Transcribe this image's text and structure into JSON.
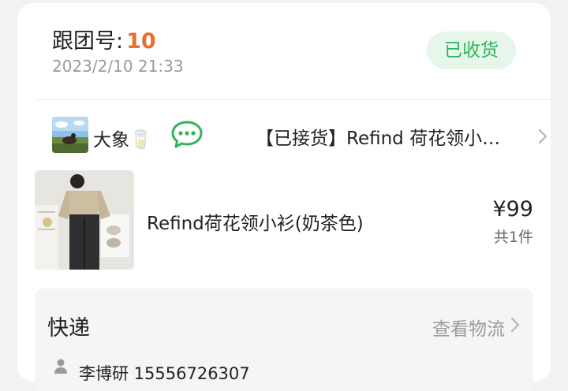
{
  "order": {
    "follow_label": "跟团号:",
    "follow_number": "10",
    "date": "2023/2/10 21:33",
    "status": "已收货"
  },
  "seller": {
    "name": "大象🥛",
    "order_title": "【已接货】Refind 荷花领小…"
  },
  "product": {
    "name": "Refind荷花领小衫(奶茶色)",
    "price": "¥99",
    "quantity": "共1件"
  },
  "shipping": {
    "title": "快递",
    "link": "查看物流",
    "recipient": "李博研  15556726307"
  },
  "colors": {
    "accent_orange": "#e86f2c",
    "status_green": "#2fb45a",
    "status_bg": "#e6f6ea",
    "chat_green": "#2fb45a"
  },
  "icons": {
    "chat": "chat-bubble-icon",
    "chevron": "chevron-right-icon",
    "person": "person-icon"
  }
}
